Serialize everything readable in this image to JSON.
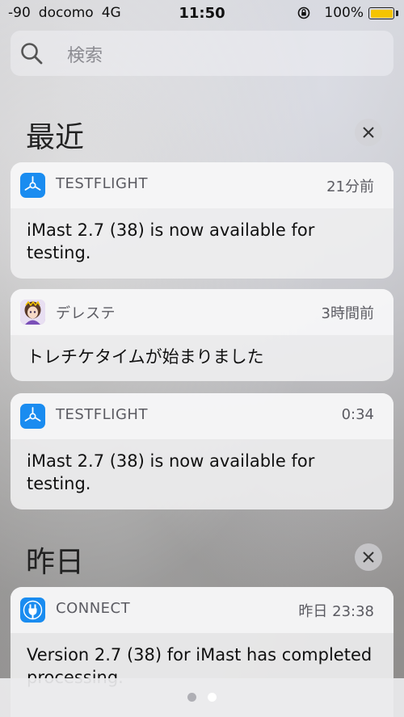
{
  "status_bar": {
    "signal": "-90",
    "carrier": "docomo",
    "network": "4G",
    "time": "11:50",
    "battery_percent": "100%",
    "battery_level": 1.0,
    "battery_color": "#f5c400"
  },
  "search": {
    "placeholder": "検索"
  },
  "sections": {
    "recent": {
      "title": "最近"
    },
    "yesterday": {
      "title": "昨日"
    }
  },
  "notifications": [
    {
      "app": "TESTFLIGHT",
      "time": "21分前",
      "message": "iMast 2.7 (38) is now available for testing.",
      "icon": "testflight-icon",
      "icon_color": "#1a8cf0"
    },
    {
      "app": "デレステ",
      "time": "3時間前",
      "message": "トレチケタイムが始まりました",
      "icon": "deresute-icon"
    },
    {
      "app": "TESTFLIGHT",
      "time": "0:34",
      "message": "iMast 2.7 (38) is now available for testing.",
      "icon": "testflight-icon",
      "icon_color": "#1a8cf0"
    },
    {
      "app": "CONNECT",
      "time": "昨日 23:38",
      "message": "Version 2.7 (38) for iMast has completed processing.",
      "icon": "itunes-connect-icon",
      "icon_color": "#1a8cf0"
    }
  ],
  "page_dots": {
    "count": 2,
    "active_index": 1
  }
}
